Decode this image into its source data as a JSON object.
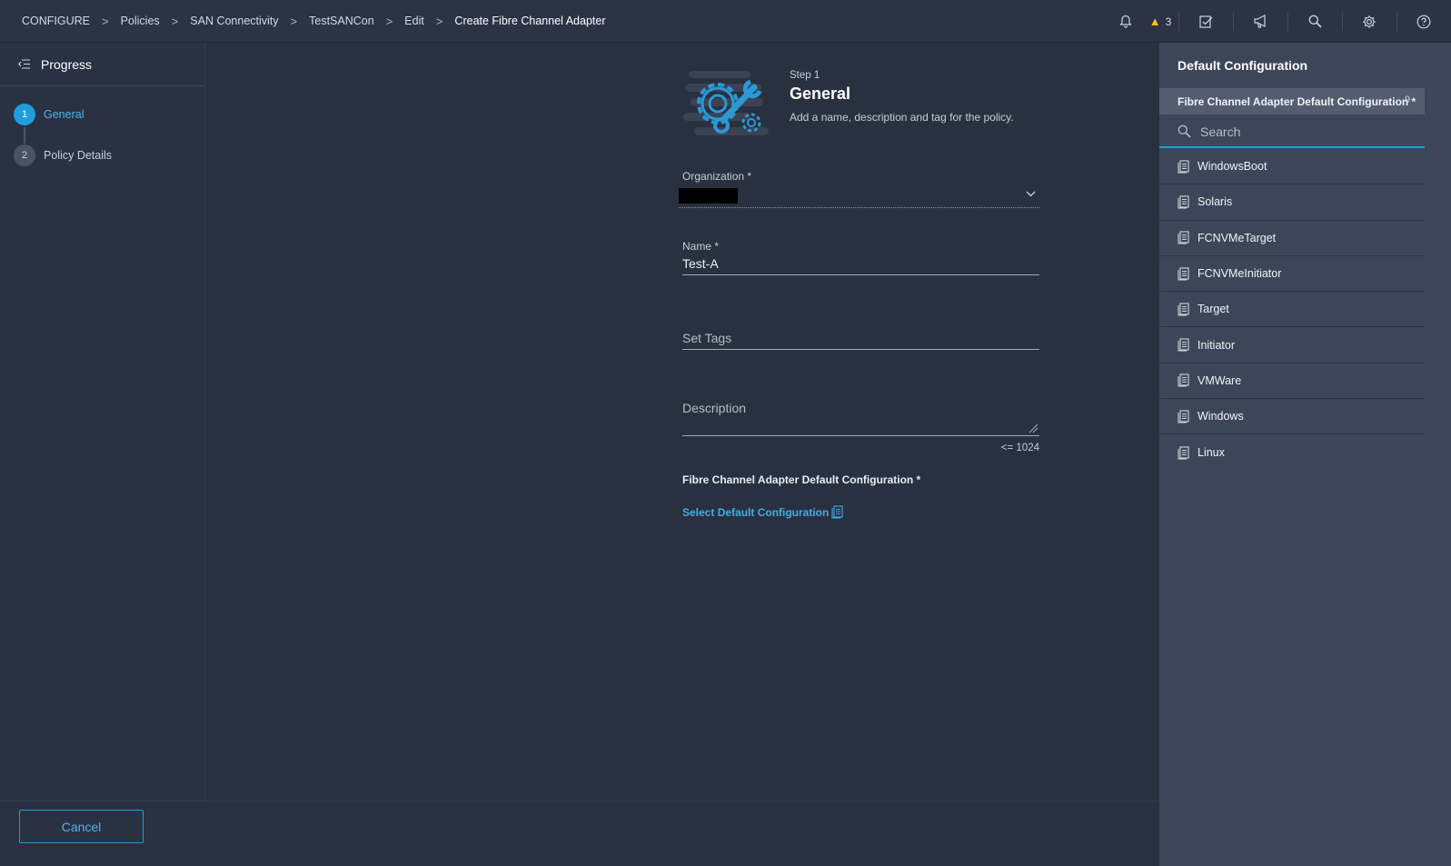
{
  "breadcrumb": [
    {
      "label": "CONFIGURE"
    },
    {
      "label": "Policies"
    },
    {
      "label": "SAN Connectivity"
    },
    {
      "label": "TestSANCon"
    },
    {
      "label": "Edit"
    }
  ],
  "breadcrumb_current": "Create Fibre Channel Adapter",
  "header": {
    "warning_count": "3",
    "icons": [
      "bell-icon",
      "warning-icon",
      "tasks-icon",
      "announcement-icon",
      "search-icon",
      "gear-icon",
      "help-icon"
    ]
  },
  "progress": {
    "title": "Progress",
    "steps": [
      {
        "num": "1",
        "label": "General"
      },
      {
        "num": "2",
        "label": "Policy Details"
      }
    ]
  },
  "step": {
    "label": "Step 1",
    "title": "General",
    "description": "Add a name, description and tag for the policy."
  },
  "form": {
    "organization_label": "Organization *",
    "name_label": "Name *",
    "name_value": "Test-A",
    "tags_placeholder": "Set Tags",
    "description_placeholder": "Description",
    "description_limit": "<= 1024",
    "default_config_label": "Fibre Channel Adapter Default Configuration *",
    "select_default_link": "Select Default Configuration"
  },
  "footer": {
    "cancel_label": "Cancel"
  },
  "right_panel": {
    "title": "Default Configuration",
    "subtitle": "Fibre Channel Adapter Default Configuration *",
    "count": "9",
    "search_placeholder": "Search",
    "items": [
      {
        "label": "WindowsBoot"
      },
      {
        "label": "Solaris"
      },
      {
        "label": "FCNVMeTarget"
      },
      {
        "label": "FCNVMeInitiator"
      },
      {
        "label": "Target"
      },
      {
        "label": "Initiator"
      },
      {
        "label": "VMWare"
      },
      {
        "label": "Windows"
      },
      {
        "label": "Linux"
      }
    ]
  },
  "colors": {
    "accent": "#1d9fdd",
    "background": "#29303f",
    "panel": "#3d4658",
    "warning": "#f5c518"
  }
}
